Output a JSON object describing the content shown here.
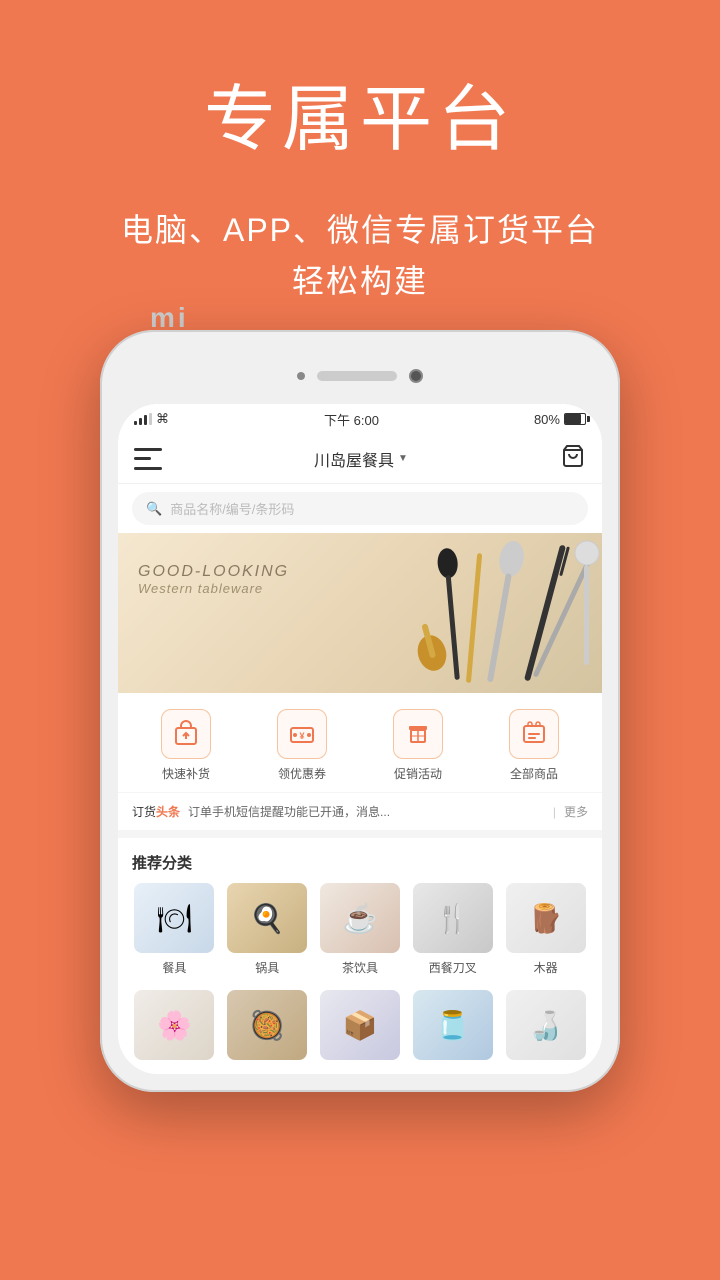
{
  "page": {
    "background_color": "#f07850"
  },
  "hero": {
    "title": "专属平台",
    "subtitle_line1": "电脑、APP、微信专属订货平台",
    "subtitle_line2": "轻松构建"
  },
  "phone": {
    "brand": "mi",
    "status_bar": {
      "signal": "..ll",
      "wifi": "wifi",
      "time": "下午 6:00",
      "battery": "80%"
    },
    "nav": {
      "store_name": "川岛屋餐具",
      "dropdown_arrow": "▼"
    },
    "search": {
      "placeholder": "商品名称/编号/条形码"
    },
    "banner": {
      "title": "GOOD-LOOKING",
      "subtitle": "Western tableware"
    },
    "quick_icons": [
      {
        "id": "restock",
        "icon": "⚡",
        "label": "快速补货"
      },
      {
        "id": "coupon",
        "icon": "¥",
        "label": "领优惠券"
      },
      {
        "id": "promo",
        "icon": "🎁",
        "label": "促销活动"
      },
      {
        "id": "all",
        "icon": "🛍",
        "label": "全部商品"
      }
    ],
    "ticker": {
      "prefix": "订货",
      "highlight": "头条",
      "content": "订单手机短信提醒功能已开通，消息...",
      "divider": "|",
      "more": "更多"
    },
    "section_title": "推荐分类",
    "categories_row1": [
      {
        "id": "tableware",
        "emoji": "🍽",
        "label": "餐具"
      },
      {
        "id": "cookware",
        "emoji": "🍳",
        "label": "锅具"
      },
      {
        "id": "teaware",
        "emoji": "🫖",
        "label": "茶饮具"
      },
      {
        "id": "western",
        "emoji": "🍴",
        "label": "西餐刀叉"
      },
      {
        "id": "wood",
        "emoji": "🪵",
        "label": "木器"
      }
    ],
    "categories_row2": [
      {
        "id": "cat2a",
        "emoji": "🌸",
        "label": ""
      },
      {
        "id": "cat2b",
        "emoji": "🥘",
        "label": ""
      },
      {
        "id": "cat2c",
        "emoji": "📦",
        "label": ""
      },
      {
        "id": "cat2d",
        "emoji": "🫙",
        "label": ""
      },
      {
        "id": "cat2e",
        "emoji": "🍶",
        "label": ""
      }
    ]
  }
}
